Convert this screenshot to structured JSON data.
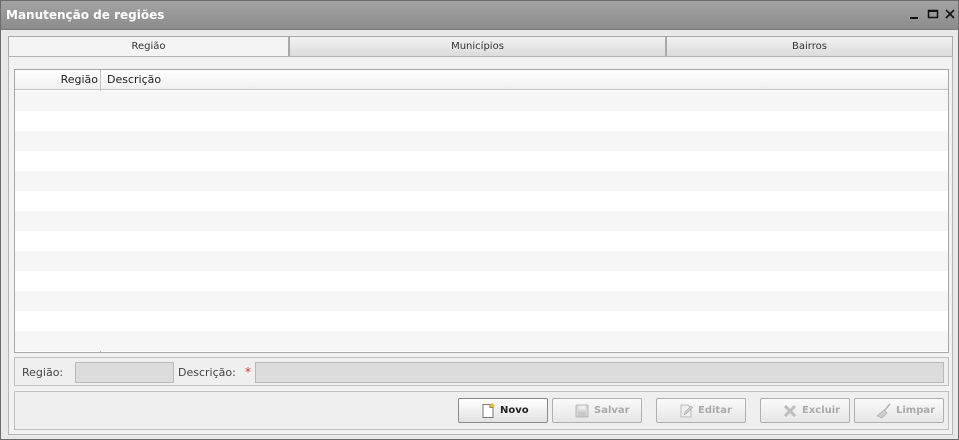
{
  "window": {
    "title": "Manutenção de regiões"
  },
  "tabs": [
    {
      "label": "Região",
      "active": true
    },
    {
      "label": "Municípios",
      "active": false
    },
    {
      "label": "Bairros",
      "active": false
    }
  ],
  "grid": {
    "columns": [
      "Região",
      "Descrição"
    ],
    "rows": []
  },
  "form": {
    "regiao_label": "Região:",
    "regiao_value": "",
    "descricao_label": "Descrição:",
    "descricao_value": "",
    "required_marker": "*"
  },
  "buttons": {
    "novo": "Novo",
    "salvar": "Salvar",
    "editar": "Editar",
    "excluir": "Excluir",
    "limpar": "Limpar"
  },
  "icons": [
    "minimize-icon",
    "maximize-icon",
    "close-icon",
    "new-document-icon",
    "save-icon",
    "edit-pencil-icon",
    "delete-x-icon",
    "clear-broom-icon"
  ]
}
